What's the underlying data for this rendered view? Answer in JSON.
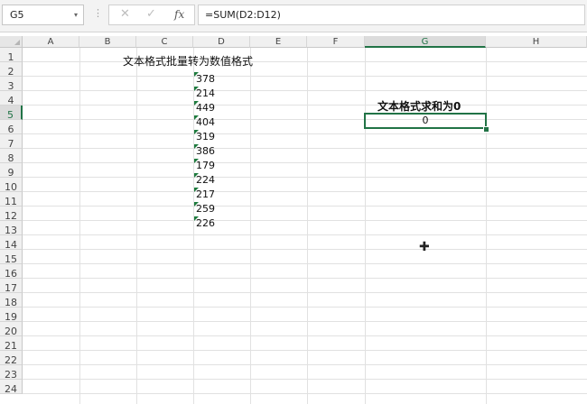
{
  "name_box": "G5",
  "name_box_dropdown": "▾",
  "separator_glyph": "⋮",
  "formula_icons": [
    "✕",
    "✓",
    "fx"
  ],
  "formula": "=SUM(D2:D12)",
  "columns": [
    "A",
    "B",
    "C",
    "D",
    "E",
    "F",
    "G",
    "H"
  ],
  "selected_column": "G",
  "rows": [
    "1",
    "2",
    "3",
    "4",
    "5",
    "6",
    "7",
    "8",
    "9",
    "10",
    "11",
    "12",
    "13",
    "14",
    "15",
    "16",
    "17",
    "18",
    "19",
    "20",
    "21",
    "22",
    "23",
    "24"
  ],
  "selected_row": "5",
  "sheet": {
    "title": "文本格式批量转为数值格式",
    "d_values": [
      "378",
      "214",
      "449",
      "404",
      "319",
      "386",
      "179",
      "224",
      "217",
      "259",
      "226"
    ],
    "g4_label": "文本格式求和为0",
    "g5_value": "0"
  },
  "colors": {
    "accent": "#217346",
    "text_indicator": "#1e7b3e",
    "gridline": "#e1e1e1"
  },
  "cursor_icon": "cross-cursor-icon"
}
